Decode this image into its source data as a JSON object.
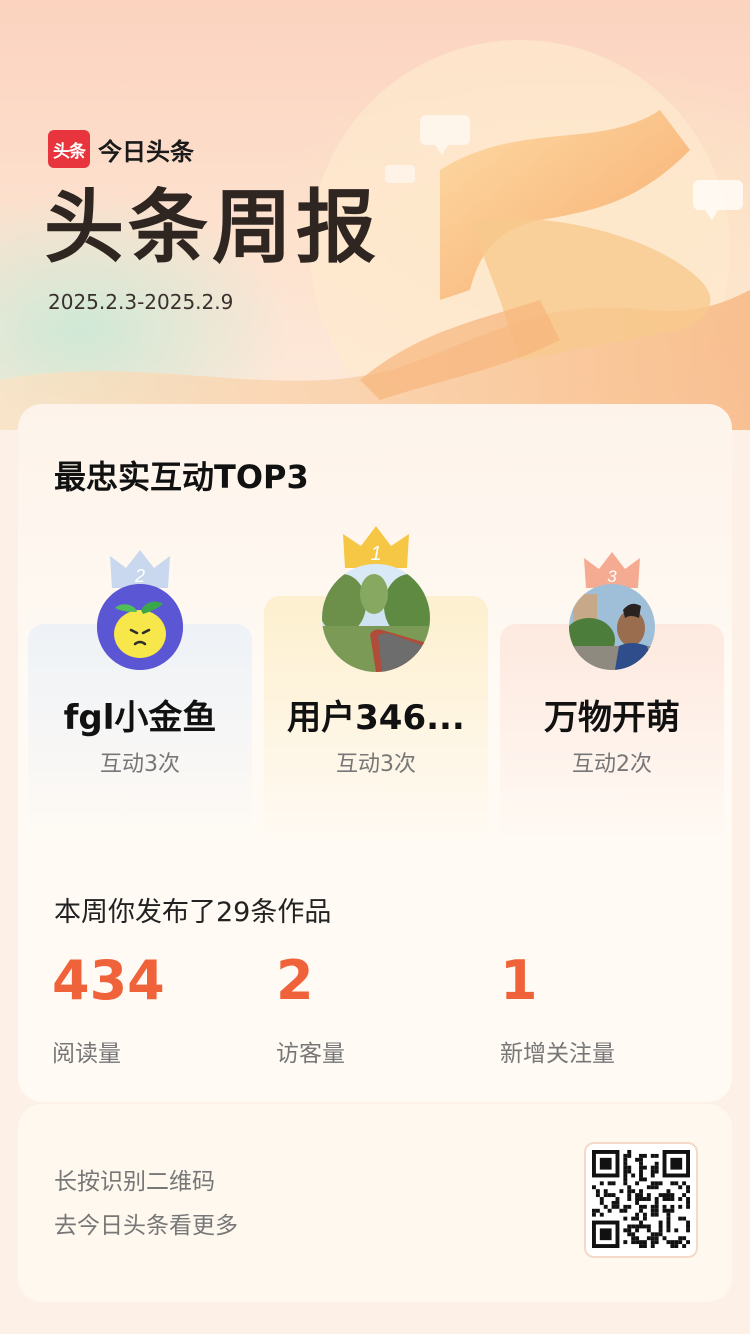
{
  "brand": {
    "logo_text": "头条",
    "name": "今日头条"
  },
  "header": {
    "title": "头条周报",
    "date_range": "2025.2.3-2025.2.9"
  },
  "top3": {
    "title": "最忠实互动TOP3",
    "users": [
      {
        "rank": "2",
        "name": "fgl小金鱼",
        "count": "互动3次",
        "avatar": "lemon-avatar-icon"
      },
      {
        "rank": "1",
        "name": "用户346...",
        "count": "互动3次",
        "avatar": "tree-road-photo"
      },
      {
        "rank": "3",
        "name": "万物开萌",
        "count": "互动2次",
        "avatar": "person-photo"
      }
    ]
  },
  "summary": {
    "published": "本周你发布了29条作品",
    "stats": [
      {
        "value": "434",
        "label": "阅读量"
      },
      {
        "value": "2",
        "label": "访客量"
      },
      {
        "value": "1",
        "label": "新增关注量"
      }
    ]
  },
  "footer": {
    "line1": "长按识别二维码",
    "line2": "去今日头条看更多"
  },
  "colors": {
    "accent": "#f0633a",
    "brand_red": "#e8353d",
    "gold": "#f5c242",
    "silver": "#c3d3ea",
    "bronze": "#f4a58a"
  }
}
